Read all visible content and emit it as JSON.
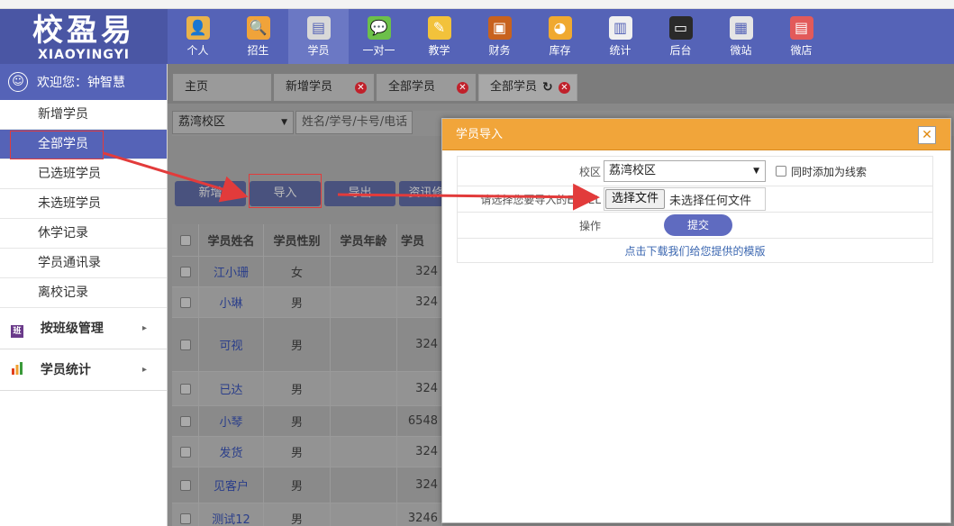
{
  "logo": {
    "cn": "校盈易",
    "en": "XIAOYINGYI"
  },
  "nav": [
    {
      "label": "个人",
      "icon": "person-icon",
      "color": "#e9b24a"
    },
    {
      "label": "招生",
      "icon": "magnifier-icon",
      "color": "#f0a33a"
    },
    {
      "label": "学员",
      "icon": "student-icon",
      "color": "#d8d8d8"
    },
    {
      "label": "一对一",
      "icon": "chat-icon",
      "color": "#6cc04a"
    },
    {
      "label": "教学",
      "icon": "pencil-notepad-icon",
      "color": "#f2c23b"
    },
    {
      "label": "财务",
      "icon": "briefcase-icon",
      "color": "#c8621e"
    },
    {
      "label": "库存",
      "icon": "pie-chart-icon",
      "color": "#f0a930"
    },
    {
      "label": "统计",
      "icon": "bar-chart-icon",
      "color": "#f0f0f0"
    },
    {
      "label": "后台",
      "icon": "monitor-icon",
      "color": "#2a2a2a"
    },
    {
      "label": "微站",
      "icon": "website-icon",
      "color": "#e5e5e5"
    },
    {
      "label": "微店",
      "icon": "shop-icon",
      "color": "#e25a5a"
    }
  ],
  "sidebar": {
    "welcome": "欢迎您：钟智慧",
    "items": [
      {
        "label": "新增学员"
      },
      {
        "label": "全部学员"
      },
      {
        "label": "已选班学员"
      },
      {
        "label": "未选班学员"
      },
      {
        "label": "休学记录"
      },
      {
        "label": "学员通讯录"
      },
      {
        "label": "离校记录"
      }
    ],
    "groups": [
      {
        "label": "按班级管理",
        "icon": "class-icon",
        "color": "#6a3a8a"
      },
      {
        "label": "学员统计",
        "icon": "stats-icon",
        "color": "#e0401e"
      }
    ]
  },
  "tabs": [
    {
      "label": "主页"
    },
    {
      "label": "新增学员"
    },
    {
      "label": "全部学员"
    },
    {
      "label": "全部学员"
    }
  ],
  "filter": {
    "campus": "荔湾校区",
    "search_placeholder": "姓名/学号/卡号/电话"
  },
  "buttons": {
    "add": "新增",
    "import": "导入",
    "export": "导出",
    "fourth": "资讯修"
  },
  "table": {
    "headers": [
      "学员姓名",
      "学员性别",
      "学员年龄",
      "学员"
    ],
    "rows": [
      {
        "name": "江小珊",
        "gender": "女",
        "age": "",
        "no": "324"
      },
      {
        "name": "小琳",
        "gender": "男",
        "age": "",
        "no": "324"
      },
      {
        "name": "可视",
        "gender": "男",
        "age": "",
        "no": "324"
      },
      {
        "name": "已达",
        "gender": "男",
        "age": "",
        "no": "324"
      },
      {
        "name": "小琴",
        "gender": "男",
        "age": "",
        "no": "6548"
      },
      {
        "name": "发货",
        "gender": "男",
        "age": "",
        "no": "324"
      },
      {
        "name": "见客户",
        "gender": "男",
        "age": "",
        "no": "324"
      },
      {
        "name": "测试12",
        "gender": "男",
        "age": "",
        "no": "3246"
      }
    ]
  },
  "modal": {
    "title": "学员导入",
    "campus_label": "校区",
    "campus_value": "荔湾校区",
    "also_add_label": "同时添加为线索",
    "file_label": "请选择您要导入的EXCEL",
    "file_button": "选择文件",
    "file_status": "未选择任何文件",
    "op_label": "操作",
    "submit": "提交",
    "download_link": "点击下载我们给您提供的模版"
  }
}
